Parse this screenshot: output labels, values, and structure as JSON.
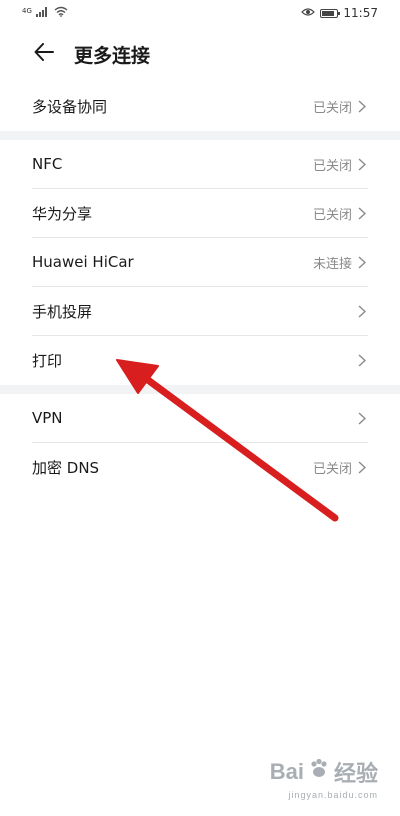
{
  "status_bar": {
    "signal_text": "4G",
    "time": "11:57"
  },
  "header": {
    "title": "更多连接"
  },
  "groups": [
    {
      "items": [
        {
          "label": "多设备协同",
          "status": "已关闭"
        }
      ]
    },
    {
      "items": [
        {
          "label": "NFC",
          "status": "已关闭"
        },
        {
          "label": "华为分享",
          "status": "已关闭"
        },
        {
          "label": "Huawei HiCar",
          "status": "未连接"
        },
        {
          "label": "手机投屏",
          "status": ""
        },
        {
          "label": "打印",
          "status": ""
        }
      ]
    },
    {
      "items": [
        {
          "label": "VPN",
          "status": ""
        },
        {
          "label": "加密 DNS",
          "status": "已关闭"
        }
      ]
    }
  ],
  "watermark": {
    "brand": "Bai",
    "brand_suffix": "经验",
    "url": "jingyan.baidu.com"
  },
  "colors": {
    "annotation_arrow": "#d81e1e",
    "divider": "#f1f3f5",
    "status_text": "#8a8a8a"
  }
}
